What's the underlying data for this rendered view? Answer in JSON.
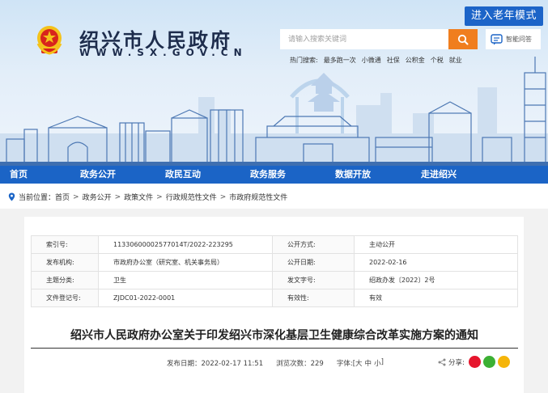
{
  "header": {
    "elder_mode": "进入老年模式",
    "site_title": "绍兴市人民政府",
    "site_url": "WWW.SX.GOV.CN",
    "search_placeholder": "请输入搜索关键词",
    "qa_label": "智能问答",
    "hot_label": "热门搜索:",
    "hot_terms": [
      "最多跑一次",
      "小微通",
      "社保",
      "公积金",
      "个税",
      "就业"
    ]
  },
  "nav": {
    "items": [
      "首页",
      "政务公开",
      "政民互动",
      "政务服务",
      "数据开放",
      "走进绍兴"
    ]
  },
  "breadcrumb": {
    "prefix": "当前位置：",
    "items": [
      "首页",
      "政务公开",
      "政策文件",
      "行政规范性文件",
      "市政府规范性文件"
    ]
  },
  "meta": {
    "rows": [
      {
        "k1": "索引号:",
        "v1": "11330600002577014T/2022-223295",
        "k2": "公开方式:",
        "v2": "主动公开"
      },
      {
        "k1": "发布机构:",
        "v1": "市政府办公室（研究室、机关事务局）",
        "k2": "公开日期:",
        "v2": "2022-02-16"
      },
      {
        "k1": "主题分类:",
        "v1": "卫生",
        "k2": "发文字号:",
        "v2": "绍政办发〔2022〕2号"
      },
      {
        "k1": "文件登记号:",
        "v1": "ZJDC01-2022-0001",
        "k2": "有效性:",
        "v2": "有效"
      }
    ]
  },
  "document": {
    "title": "绍兴市人民政府办公室关于印发绍兴市深化基层卫生健康综合改革实施方案的通知",
    "publish_label": "发布日期：2022-02-17 11:51",
    "views_label": "浏览次数：229",
    "font_label": "字体:[",
    "font_large": "大",
    "font_medium": "中",
    "font_small": "小",
    "font_close": "]",
    "share_label": "分享:"
  },
  "colors": {
    "nav_blue": "#1b64c6",
    "search_orange": "#f07e1e",
    "weibo_red": "#e6162d",
    "wechat_green": "#3cb034",
    "qzone_yellow": "#f5b50a"
  }
}
